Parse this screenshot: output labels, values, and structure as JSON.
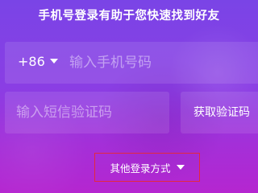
{
  "header": {
    "title": "手机号登录有助于您快速找到好友"
  },
  "phone": {
    "country_code": "+86",
    "placeholder": "输入手机号码",
    "value": ""
  },
  "verification": {
    "placeholder": "输入短信验证码",
    "value": "",
    "get_code_label": "获取验证码"
  },
  "other_login": {
    "label": "其他登录方式"
  },
  "colors": {
    "gradient_top": "#7a44e6",
    "gradient_bottom": "#b526d0",
    "highlight_border": "#e4283f",
    "text": "#ffffff"
  }
}
